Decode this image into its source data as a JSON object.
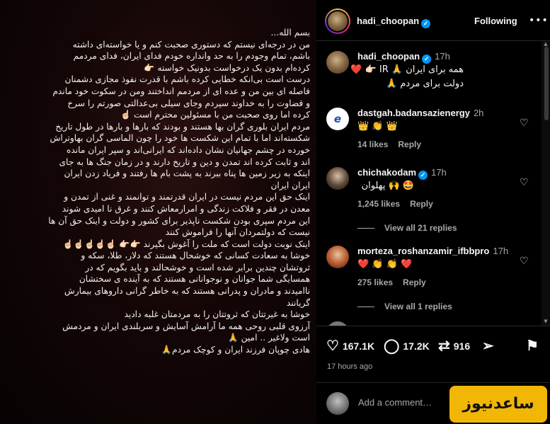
{
  "post_image": {
    "lines": [
      "بسم الله...",
      "من در درجه‌ای نیستم که دستوری صحبت کنم و یا خواسته‌ای داشته",
      "باشم، تمام وجودم  را به حد وانداره خودم فدای ایران، فدای مردمم",
      "کرده‌ام بدون یک درخواست بدونیک خواسته 👉🏻",
      "درست است بی‌انکه خطایی کرده باشم با قدرت نفوذ مجازی دشمنان",
      "فاصله ای بین من و عده ای از مردمم انداختند ومن در سکوت خود ماندم",
      "و قضاوت را به خداوند سپردم وجای سیلی بی‌عدالتی صورتم را سرخ",
      "کرده اما روی صحبت من با مسئولین محترم است ☝🏻",
      "مردم ایران بلوری گران بها هستند و بودند که بارها و بارها در طول تاریخ",
      "شکسته‌اند اما با تمام این شکست ها خود را چون الماسی گران بهاوتراش",
      "خورده در چشم جهانیان نشان داده‌اند که ایرانی‌اند و سپر ایران مانده",
      "اند و ثابت کرده اند تمدن و دین و تاریخ دارند و در زمان جنگ ها به جای",
      "اینکه به زیر زمین ها پناه  ببرند به پشت بام ها رفتند و فریاد زدن ایران",
      "ایران ایران",
      "اینک حق این مردم نیست در ایران قدرتمند و توانمند و غنی از تمدن و",
      "معدن در فقر و فلاکت زندگی و امرارمعاش کنند و غرق نا امیدی شوند",
      "این مردم سپری بودن شکست ناپذیر برای کشور و دولت و اینک حق آن ها",
      "نیست که دولتمردان آنها را فراموش کنند",
      "اینک نوبت دولت است که ملت را آغوش بگیرند 👉🏻👉🏻 ☝🏻☝🏻☝🏻☝🏻☝🏻",
      "خوشا به سعادت کسانی که خوشحال هستند که دلار، طلا، سکه و",
      "ثروتشان چندین برابر شده است و خوشحالند و باید بگویم که در",
      "همسایگی شما جوانان و نوجوانانی هستند که به آینده ی سختشان",
      "ناامیدند و مادران و پدرانی هستند که به خاطر گرانی داروهای بیمارش",
      "گریانند",
      "خوشا به غیرتتان که ثروتتان را به مردمتان غلبه دادید",
      "آرزوی قلبی روحی همه ما آرامش آسایش و سربلندی ایران و مردمش",
      "است ولاغیر .. امین 🙏",
      "هادی چوپان  فرزند ایران و کوچک مردم🙏"
    ]
  },
  "header": {
    "username": "hadi_choopan",
    "following_label": "Following",
    "more_label": "•••"
  },
  "caption": {
    "author": "hadi_choopan",
    "time": "17h",
    "line1": "همه برای ایران 🙏 IR 👉🏻 ❤️",
    "line2": "دولت برای مردم 🙏"
  },
  "comments": [
    {
      "author": "dastgah.badansazienergy",
      "time": "2h",
      "text": "👑 👏 👑",
      "likes": "14 likes",
      "reply": "Reply"
    },
    {
      "author": "chichakodam",
      "time": "17h",
      "text": "🤩 🙌 پهلوان",
      "likes": "1,245 likes",
      "reply": "Reply",
      "replies": "View all 21 replies"
    },
    {
      "author": "morteza_roshanzamir_ifbbpro",
      "time": "17h",
      "text": "❤️ 👏 👏 ❤️",
      "likes": "275 likes",
      "reply": "Reply",
      "replies": "View all 1 replies"
    }
  ],
  "actions": {
    "likes": "167.1K",
    "comments": "17.2K",
    "reposts": "916",
    "timestamp": "17 hours ago"
  },
  "add_comment": {
    "placeholder": "Add a comment…",
    "watermark": "ساعدنیوز"
  },
  "colors": {
    "accent_blue": "#0095f6",
    "watermark_yellow": "#f2b705"
  }
}
